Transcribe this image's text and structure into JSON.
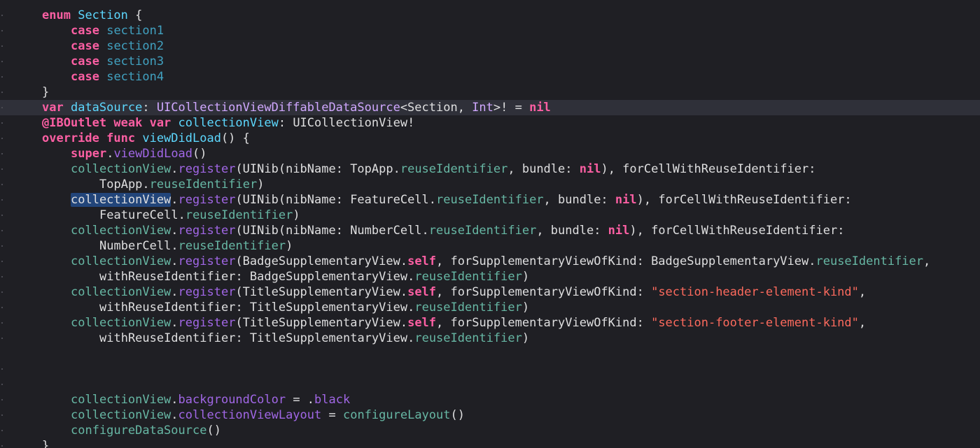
{
  "editor": {
    "theme_colors": {
      "background": "#1f1f24",
      "current_line": "#2f3039",
      "keyword": "#fc5fa3",
      "type_declaration": "#5dd8ff",
      "system_type": "#d0a8ff",
      "project_property": "#67b7a4",
      "system_method": "#a167e6",
      "string": "#fc6a5d",
      "selection": "#22457a"
    },
    "current_line_index": 6,
    "lines": [
      {
        "indent": 0,
        "tokens": [
          {
            "c": "kw",
            "v": "enum"
          },
          {
            "c": "plain",
            "v": " "
          },
          {
            "c": "type-decl",
            "v": "Section"
          },
          {
            "c": "plain",
            "v": " {"
          }
        ]
      },
      {
        "indent": 1,
        "tokens": [
          {
            "c": "kw",
            "v": "case"
          },
          {
            "c": "plain",
            "v": " "
          },
          {
            "c": "case-name",
            "v": "section1"
          }
        ]
      },
      {
        "indent": 1,
        "tokens": [
          {
            "c": "kw",
            "v": "case"
          },
          {
            "c": "plain",
            "v": " "
          },
          {
            "c": "case-name",
            "v": "section2"
          }
        ]
      },
      {
        "indent": 1,
        "tokens": [
          {
            "c": "kw",
            "v": "case"
          },
          {
            "c": "plain",
            "v": " "
          },
          {
            "c": "case-name",
            "v": "section3"
          }
        ]
      },
      {
        "indent": 1,
        "tokens": [
          {
            "c": "kw",
            "v": "case"
          },
          {
            "c": "plain",
            "v": " "
          },
          {
            "c": "case-name",
            "v": "section4"
          }
        ]
      },
      {
        "indent": 0,
        "tokens": [
          {
            "c": "plain",
            "v": "}"
          }
        ]
      },
      {
        "indent": 0,
        "tokens": [
          {
            "c": "kw",
            "v": "var"
          },
          {
            "c": "plain",
            "v": " "
          },
          {
            "c": "type-decl",
            "v": "dataSource"
          },
          {
            "c": "plain",
            "v": ": "
          },
          {
            "c": "type-sys",
            "v": "UICollectionViewDiffableDataSource"
          },
          {
            "c": "plain",
            "v": "<Section, "
          },
          {
            "c": "type-sys",
            "v": "Int"
          },
          {
            "c": "plain",
            "v": ">! = "
          },
          {
            "c": "kw",
            "v": "nil"
          }
        ]
      },
      {
        "indent": 0,
        "tokens": [
          {
            "c": "kw",
            "v": "@IBOutlet"
          },
          {
            "c": "plain",
            "v": " "
          },
          {
            "c": "kw",
            "v": "weak"
          },
          {
            "c": "plain",
            "v": " "
          },
          {
            "c": "kw",
            "v": "var"
          },
          {
            "c": "plain",
            "v": " "
          },
          {
            "c": "type-decl",
            "v": "collectionView"
          },
          {
            "c": "plain",
            "v": ": UICollectionView!"
          }
        ]
      },
      {
        "indent": 0,
        "tokens": [
          {
            "c": "kw",
            "v": "override"
          },
          {
            "c": "plain",
            "v": " "
          },
          {
            "c": "kw",
            "v": "func"
          },
          {
            "c": "plain",
            "v": " "
          },
          {
            "c": "type-decl",
            "v": "viewDidLoad"
          },
          {
            "c": "plain",
            "v": "() {"
          }
        ]
      },
      {
        "indent": 1,
        "tokens": [
          {
            "c": "kw",
            "v": "super"
          },
          {
            "c": "plain",
            "v": "."
          },
          {
            "c": "method-sys",
            "v": "viewDidLoad"
          },
          {
            "c": "plain",
            "v": "()"
          }
        ]
      },
      {
        "indent": 1,
        "tokens": [
          {
            "c": "prop-proj",
            "v": "collectionView"
          },
          {
            "c": "plain",
            "v": "."
          },
          {
            "c": "method-sys",
            "v": "register"
          },
          {
            "c": "plain",
            "v": "(UINib(nibName: TopApp."
          },
          {
            "c": "prop-proj",
            "v": "reuseIdentifier"
          },
          {
            "c": "plain",
            "v": ", bundle: "
          },
          {
            "c": "kw",
            "v": "nil"
          },
          {
            "c": "plain",
            "v": "), forCellWithReuseIdentifier:"
          }
        ]
      },
      {
        "indent": 2,
        "tokens": [
          {
            "c": "plain",
            "v": "TopApp."
          },
          {
            "c": "prop-proj",
            "v": "reuseIdentifier"
          },
          {
            "c": "plain",
            "v": ")"
          }
        ]
      },
      {
        "indent": 1,
        "tokens": [
          {
            "c": "sel",
            "v": "collectionView"
          },
          {
            "c": "plain",
            "v": "."
          },
          {
            "c": "method-sys",
            "v": "register"
          },
          {
            "c": "plain",
            "v": "(UINib(nibName: FeatureCell."
          },
          {
            "c": "prop-proj",
            "v": "reuseIdentifier"
          },
          {
            "c": "plain",
            "v": ", bundle: "
          },
          {
            "c": "kw",
            "v": "nil"
          },
          {
            "c": "plain",
            "v": "), forCellWithReuseIdentifier:"
          }
        ]
      },
      {
        "indent": 2,
        "tokens": [
          {
            "c": "plain",
            "v": "FeatureCell."
          },
          {
            "c": "prop-proj",
            "v": "reuseIdentifier"
          },
          {
            "c": "plain",
            "v": ")"
          }
        ]
      },
      {
        "indent": 1,
        "tokens": [
          {
            "c": "prop-proj",
            "v": "collectionView"
          },
          {
            "c": "plain",
            "v": "."
          },
          {
            "c": "method-sys",
            "v": "register"
          },
          {
            "c": "plain",
            "v": "(UINib(nibName: NumberCell."
          },
          {
            "c": "prop-proj",
            "v": "reuseIdentifier"
          },
          {
            "c": "plain",
            "v": ", bundle: "
          },
          {
            "c": "kw",
            "v": "nil"
          },
          {
            "c": "plain",
            "v": "), forCellWithReuseIdentifier:"
          }
        ]
      },
      {
        "indent": 2,
        "tokens": [
          {
            "c": "plain",
            "v": "NumberCell."
          },
          {
            "c": "prop-proj",
            "v": "reuseIdentifier"
          },
          {
            "c": "plain",
            "v": ")"
          }
        ]
      },
      {
        "indent": 1,
        "tokens": [
          {
            "c": "prop-proj",
            "v": "collectionView"
          },
          {
            "c": "plain",
            "v": "."
          },
          {
            "c": "method-sys",
            "v": "register"
          },
          {
            "c": "plain",
            "v": "(BadgeSupplementaryView."
          },
          {
            "c": "kw",
            "v": "self"
          },
          {
            "c": "plain",
            "v": ", forSupplementaryViewOfKind: BadgeSupplementaryView."
          },
          {
            "c": "prop-proj",
            "v": "reuseIdentifier"
          },
          {
            "c": "plain",
            "v": ","
          }
        ]
      },
      {
        "indent": 2,
        "tokens": [
          {
            "c": "plain",
            "v": "withReuseIdentifier: BadgeSupplementaryView."
          },
          {
            "c": "prop-proj",
            "v": "reuseIdentifier"
          },
          {
            "c": "plain",
            "v": ")"
          }
        ]
      },
      {
        "indent": 1,
        "tokens": [
          {
            "c": "prop-proj",
            "v": "collectionView"
          },
          {
            "c": "plain",
            "v": "."
          },
          {
            "c": "method-sys",
            "v": "register"
          },
          {
            "c": "plain",
            "v": "(TitleSupplementaryView."
          },
          {
            "c": "kw",
            "v": "self"
          },
          {
            "c": "plain",
            "v": ", forSupplementaryViewOfKind: "
          },
          {
            "c": "str",
            "v": "\"section-header-element-kind\""
          },
          {
            "c": "plain",
            "v": ","
          }
        ]
      },
      {
        "indent": 2,
        "tokens": [
          {
            "c": "plain",
            "v": "withReuseIdentifier: TitleSupplementaryView."
          },
          {
            "c": "prop-proj",
            "v": "reuseIdentifier"
          },
          {
            "c": "plain",
            "v": ")"
          }
        ]
      },
      {
        "indent": 1,
        "tokens": [
          {
            "c": "prop-proj",
            "v": "collectionView"
          },
          {
            "c": "plain",
            "v": "."
          },
          {
            "c": "method-sys",
            "v": "register"
          },
          {
            "c": "plain",
            "v": "(TitleSupplementaryView."
          },
          {
            "c": "kw",
            "v": "self"
          },
          {
            "c": "plain",
            "v": ", forSupplementaryViewOfKind: "
          },
          {
            "c": "str",
            "v": "\"section-footer-element-kind\""
          },
          {
            "c": "plain",
            "v": ","
          }
        ]
      },
      {
        "indent": 2,
        "tokens": [
          {
            "c": "plain",
            "v": "withReuseIdentifier: TitleSupplementaryView."
          },
          {
            "c": "prop-proj",
            "v": "reuseIdentifier"
          },
          {
            "c": "plain",
            "v": ")"
          }
        ]
      },
      {
        "indent": 0,
        "tokens": []
      },
      {
        "indent": 0,
        "tokens": []
      },
      {
        "indent": 1,
        "tokens": [
          {
            "c": "prop-proj",
            "v": "collectionView"
          },
          {
            "c": "plain",
            "v": "."
          },
          {
            "c": "method-sys",
            "v": "backgroundColor"
          },
          {
            "c": "plain",
            "v": " = ."
          },
          {
            "c": "method-sys",
            "v": "black"
          }
        ]
      },
      {
        "indent": 1,
        "tokens": [
          {
            "c": "prop-proj",
            "v": "collectionView"
          },
          {
            "c": "plain",
            "v": "."
          },
          {
            "c": "method-sys",
            "v": "collectionViewLayout"
          },
          {
            "c": "plain",
            "v": " = "
          },
          {
            "c": "prop-proj",
            "v": "configureLayout"
          },
          {
            "c": "plain",
            "v": "()"
          }
        ]
      },
      {
        "indent": 1,
        "tokens": [
          {
            "c": "prop-proj",
            "v": "configureDataSource"
          },
          {
            "c": "plain",
            "v": "()"
          }
        ]
      },
      {
        "indent": 0,
        "tokens": [
          {
            "c": "plain",
            "v": "}"
          }
        ]
      }
    ]
  }
}
